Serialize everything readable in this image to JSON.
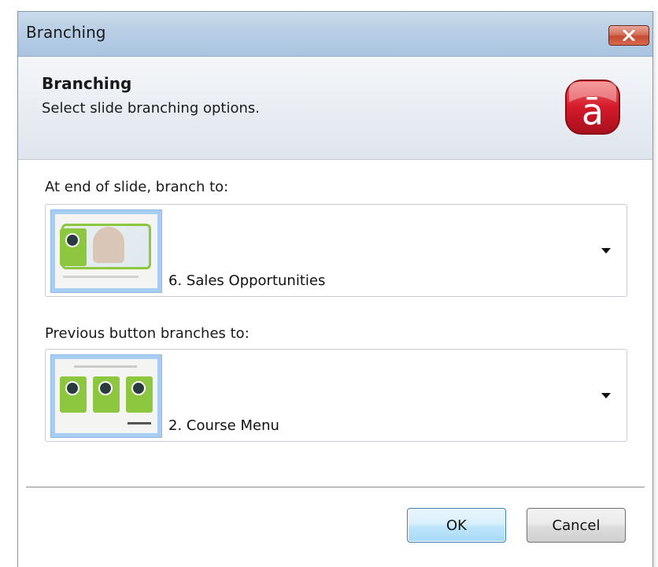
{
  "window": {
    "title": "Branching",
    "close_icon": "close-icon"
  },
  "header": {
    "title": "Branching",
    "subtitle": "Select slide branching options.",
    "logo_icon": "adobe-presenter-logo",
    "logo_letter": "ā"
  },
  "end_of_slide": {
    "label": "At end of slide, branch to:",
    "selected": "6. Sales Opportunities"
  },
  "previous_button": {
    "label": "Previous button branches to:",
    "selected": "2. Course Menu"
  },
  "buttons": {
    "ok": "OK",
    "cancel": "Cancel"
  },
  "colors": {
    "accent_green": "#8dc63f",
    "logo_red": "#c8102e",
    "titlebar_blue": "#b8cee5"
  }
}
